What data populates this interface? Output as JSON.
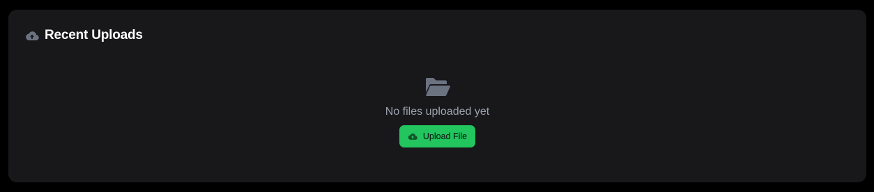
{
  "card": {
    "title": "Recent Uploads",
    "title_icon": "cloud-upload-icon"
  },
  "empty_state": {
    "icon": "folder-open-icon",
    "message": "No files uploaded yet",
    "button_label": "Upload File",
    "button_icon": "cloud-upload-icon"
  },
  "colors": {
    "page_background": "#000000",
    "card_background": "#18181b",
    "title_text": "#ffffff",
    "muted_icon": "#6b7280",
    "muted_text": "#9ca3af",
    "accent": "#22c55e"
  }
}
